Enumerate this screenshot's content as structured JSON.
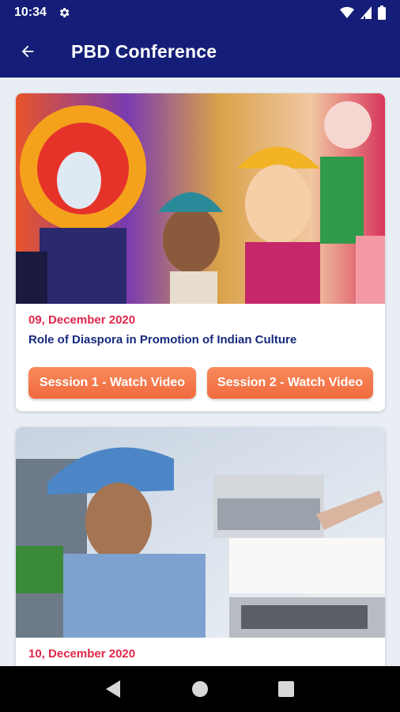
{
  "status_bar": {
    "time": "10:34"
  },
  "app_bar": {
    "title": "PBD Conference"
  },
  "cards": [
    {
      "date": "09, December 2020",
      "title": "Role of Diaspora in Promotion of Indian Culture",
      "buttons": [
        "Session 1 - Watch Video",
        "Session 2 - Watch Video"
      ]
    },
    {
      "date": "10, December 2020"
    }
  ],
  "colors": {
    "primary": "#141e78",
    "accent_date": "#e0284a",
    "title": "#172a7c",
    "button": "#f47a4a"
  },
  "icons": [
    "settings-gear-icon",
    "wifi-icon",
    "signal-icon",
    "battery-icon",
    "back-arrow-icon",
    "nav-back-icon",
    "nav-home-icon",
    "nav-recents-icon"
  ]
}
